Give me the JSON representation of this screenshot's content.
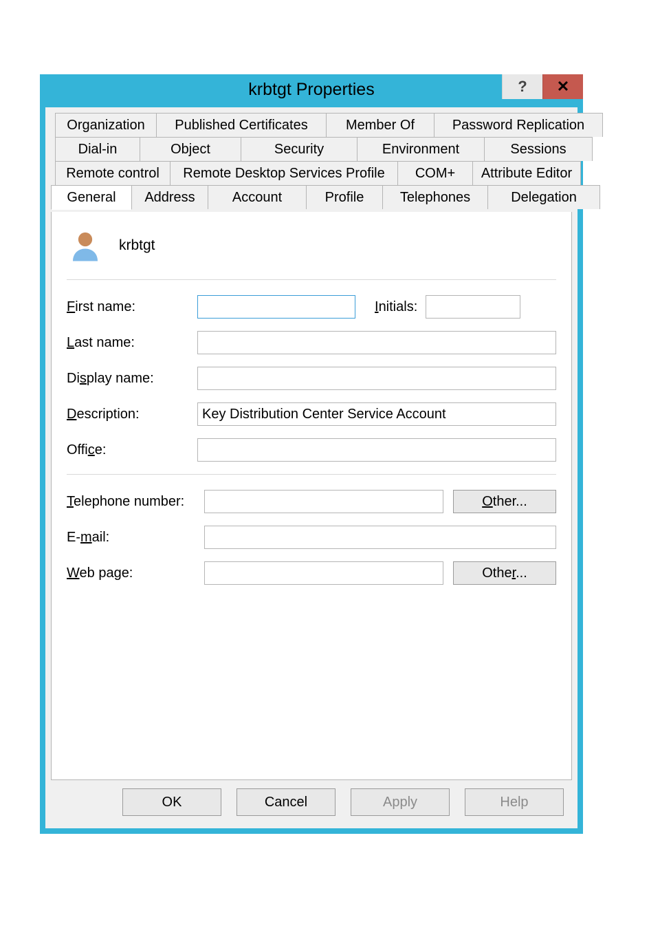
{
  "titlebar": {
    "title": "krbtgt Properties",
    "help": "?",
    "close": "✕"
  },
  "tabs": {
    "row1": [
      "Organization",
      "Published Certificates",
      "Member Of",
      "Password Replication"
    ],
    "row2": [
      "Dial-in",
      "Object",
      "Security",
      "Environment",
      "Sessions"
    ],
    "row3": [
      "Remote control",
      "Remote Desktop Services Profile",
      "COM+",
      "Attribute Editor"
    ],
    "row4": [
      "General",
      "Address",
      "Account",
      "Profile",
      "Telephones",
      "Delegation"
    ]
  },
  "header": {
    "name": "krbtgt"
  },
  "fields": {
    "first_name": {
      "label": "First name:",
      "value": ""
    },
    "initials": {
      "label": "Initials:",
      "value": ""
    },
    "last_name": {
      "label": "Last name:",
      "value": ""
    },
    "display_name": {
      "label": "Display name:",
      "value": ""
    },
    "description": {
      "label": "Description:",
      "value": "Key Distribution Center Service Account"
    },
    "office": {
      "label": "Office:",
      "value": ""
    },
    "telephone": {
      "label": "Telephone number:",
      "value": "",
      "other": "Other..."
    },
    "email": {
      "label": "E-mail:",
      "value": ""
    },
    "webpage": {
      "label": "Web page:",
      "value": "",
      "other": "Other..."
    }
  },
  "actions": {
    "ok": "OK",
    "cancel": "Cancel",
    "apply": "Apply",
    "help": "Help"
  }
}
